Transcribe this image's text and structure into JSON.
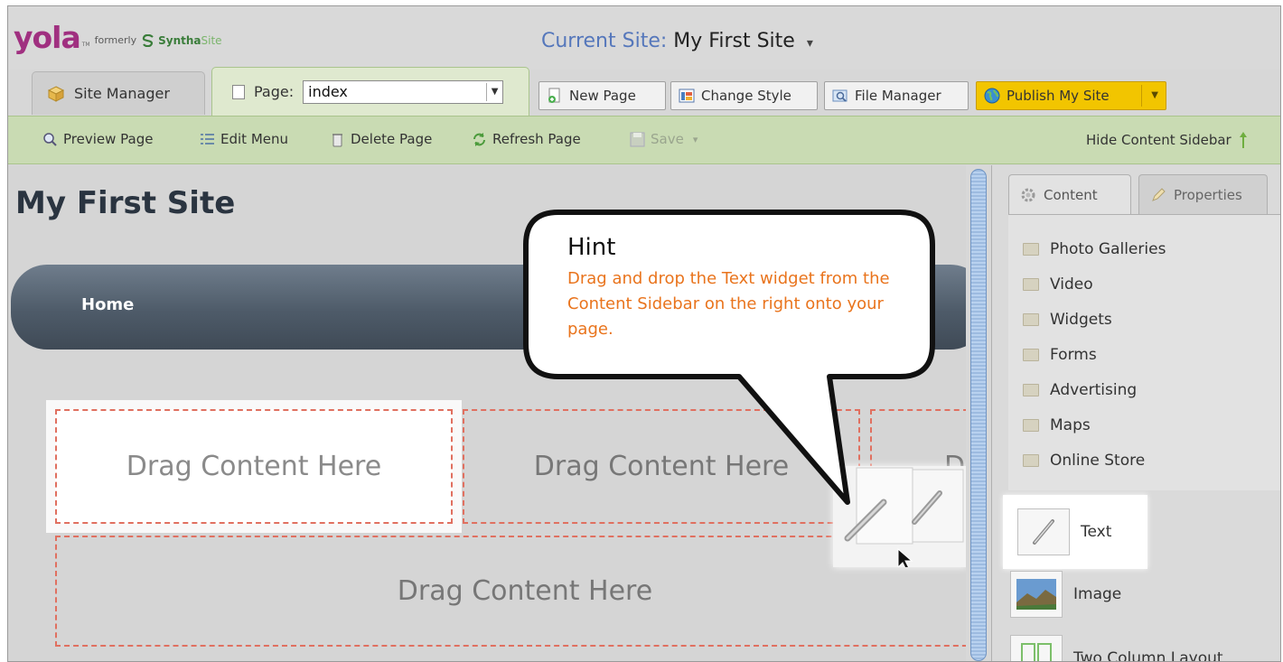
{
  "header": {
    "logo": {
      "brand": "yola",
      "tm": "TM",
      "formerly": "formerly",
      "synth_bold": "Syntha",
      "synth_light": "Site"
    },
    "current_site_label": "Current Site:",
    "current_site_value": "My First Site",
    "current_site_caret": "▾"
  },
  "tabs": {
    "site_manager": "Site Manager",
    "page_label": "Page:",
    "page_select_value": "index"
  },
  "toolbar_buttons": {
    "new_page": "New Page",
    "change_style": "Change Style",
    "file_manager": "File Manager",
    "publish": "Publish My Site"
  },
  "page_toolbar": {
    "preview": "Preview Page",
    "edit_menu": "Edit Menu",
    "delete": "Delete Page",
    "refresh": "Refresh Page",
    "save": "Save",
    "save_caret": "▾",
    "hide_sidebar": "Hide Content Sidebar"
  },
  "canvas": {
    "site_title": "My First Site",
    "nav_items": [
      "Home"
    ],
    "drop_zones": [
      "Drag Content Here",
      "Drag Content Here",
      "D",
      "Drag Content Here"
    ]
  },
  "hint": {
    "title": "Hint",
    "text": "Drag and drop the Text widget from the Content Sidebar on the right onto your page."
  },
  "sidebar": {
    "tabs": [
      "Content",
      "Properties"
    ],
    "folders": [
      "Photo Galleries",
      "Video",
      "Widgets",
      "Forms",
      "Advertising",
      "Maps",
      "Online Store"
    ],
    "widgets": [
      "Text",
      "Image",
      "Two Column Layout"
    ]
  },
  "colors": {
    "brand": "#a03080",
    "publish": "#f2c500",
    "toolbar_green": "#c9dbb3",
    "hint_text": "#e9741d",
    "drop_border": "#e07060"
  }
}
